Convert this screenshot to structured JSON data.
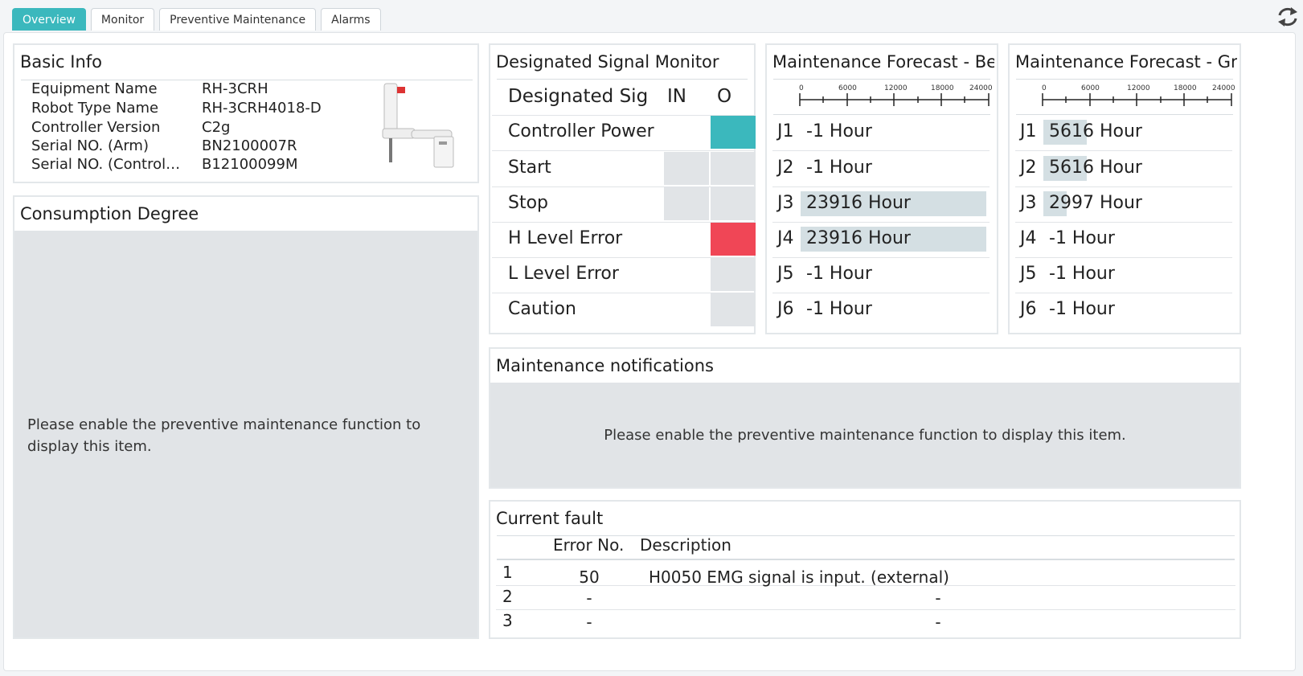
{
  "tabs": [
    {
      "label": "Overview",
      "active": true
    },
    {
      "label": "Monitor",
      "active": false
    },
    {
      "label": "Preventive Maintenance",
      "active": false
    },
    {
      "label": "Alarms",
      "active": false
    }
  ],
  "refresh_icon": "refresh-icon",
  "basic_info": {
    "title": "Basic Info",
    "rows": [
      {
        "key": "Equipment Name",
        "value": "RH-3CRH"
      },
      {
        "key": "Robot Type Name",
        "value": "RH-3CRH4018-D"
      },
      {
        "key": "Controller Version",
        "value": "C2g"
      },
      {
        "key": "Serial NO. (Arm)",
        "value": "BN2100007R"
      },
      {
        "key": "Serial NO. (Controller)",
        "value": "B12100099M"
      }
    ],
    "robot_icon": "scara-robot-image"
  },
  "consumption": {
    "title": "Consumption Degree",
    "message": "Please enable the preventive maintenance function to display this item."
  },
  "signal_monitor": {
    "title": "Designated Signal Monitor",
    "headers": {
      "name": "Designated Sig",
      "in": "IN",
      "out": "O"
    },
    "rows": [
      {
        "label": "Controller Power",
        "in_color": "",
        "out_color": "#3bb8bd"
      },
      {
        "label": "Start",
        "in_color": "#e1e4e7",
        "out_color": "#e1e4e7"
      },
      {
        "label": "Stop",
        "in_color": "#e1e4e7",
        "out_color": "#e1e4e7"
      },
      {
        "label": "H Level Error",
        "in_color": "",
        "out_color": "#f04656"
      },
      {
        "label": "L Level Error",
        "in_color": "",
        "out_color": "#e1e4e7"
      },
      {
        "label": "Caution",
        "in_color": "",
        "out_color": "#e1e4e7"
      }
    ]
  },
  "forecast_belt": {
    "title": "Maintenance Forecast - Belt",
    "axis": {
      "ticks": [
        "0",
        "6000",
        "12000",
        "18000",
        "24000"
      ],
      "max": 24000
    },
    "rows": [
      {
        "joint": "J1",
        "value": -1,
        "label": "-1 Hour"
      },
      {
        "joint": "J2",
        "value": -1,
        "label": "-1 Hour"
      },
      {
        "joint": "J3",
        "value": 23916,
        "label": "23916 Hour"
      },
      {
        "joint": "J4",
        "value": 23916,
        "label": "23916 Hour"
      },
      {
        "joint": "J5",
        "value": -1,
        "label": "-1 Hour"
      },
      {
        "joint": "J6",
        "value": -1,
        "label": "-1 Hour"
      }
    ]
  },
  "forecast_grease": {
    "title": "Maintenance Forecast - Gre",
    "axis": {
      "ticks": [
        "0",
        "6000",
        "12000",
        "18000",
        "24000"
      ],
      "max": 24000
    },
    "rows": [
      {
        "joint": "J1",
        "value": 5616,
        "label": "5616 Hour"
      },
      {
        "joint": "J2",
        "value": 5616,
        "label": "5616 Hour"
      },
      {
        "joint": "J3",
        "value": 2997,
        "label": "2997 Hour"
      },
      {
        "joint": "J4",
        "value": -1,
        "label": "-1 Hour"
      },
      {
        "joint": "J5",
        "value": -1,
        "label": "-1 Hour"
      },
      {
        "joint": "J6",
        "value": -1,
        "label": "-1 Hour"
      }
    ]
  },
  "notifications": {
    "title": "Maintenance notifications",
    "message": "Please enable the preventive maintenance function to display this item."
  },
  "current_fault": {
    "title": "Current fault",
    "headers": {
      "index": "",
      "error_no": "Error No.",
      "description": "Description"
    },
    "rows": [
      {
        "index": "1",
        "error_no": "50",
        "description": "H0050 EMG signal is input. (external)"
      },
      {
        "index": "2",
        "error_no": "-",
        "description": "-"
      },
      {
        "index": "3",
        "error_no": "-",
        "description": "-"
      }
    ]
  }
}
